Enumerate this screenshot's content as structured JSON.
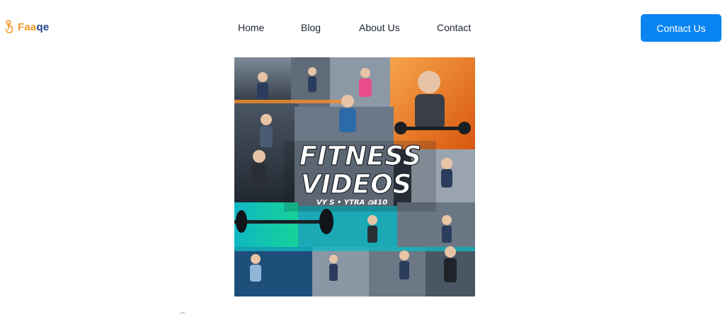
{
  "brand": {
    "name": "Faaqe"
  },
  "nav": {
    "home": "Home",
    "blog": "Blog",
    "about": "About Us",
    "contact": "Contact"
  },
  "cta": {
    "label": "Contact Us"
  },
  "hero": {
    "title_line1": "FITNESS",
    "title_line2": "VIDEOS",
    "subtitle": "VY S • YTRA ଥ410"
  },
  "colors": {
    "accent": "#0b84f3",
    "logo_orange": "#f39a2b",
    "logo_blue": "#1f3f8a"
  }
}
